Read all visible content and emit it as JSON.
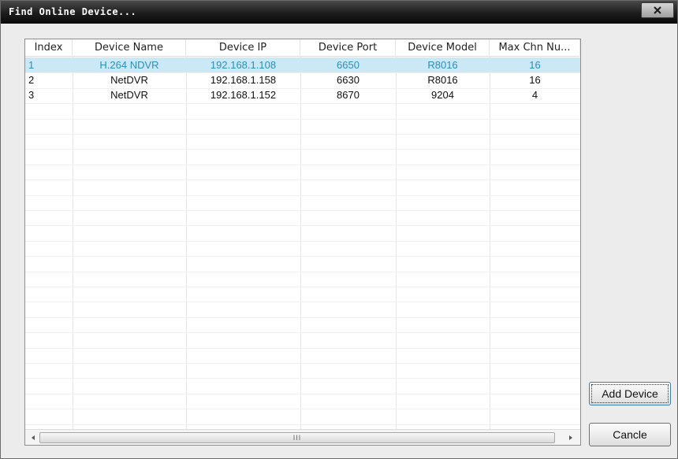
{
  "window": {
    "title": "Find Online Device...",
    "close_glyph": "x"
  },
  "table": {
    "columns": [
      "Index",
      "Device Name",
      "Device IP",
      "Device Port",
      "Device Model",
      "Max Chn Nu..."
    ],
    "rows": [
      {
        "index": "1",
        "name": "H.264 NDVR",
        "ip": "192.168.1.108",
        "port": "6650",
        "model": "R8016",
        "max_chn": "16",
        "selected": true
      },
      {
        "index": "2",
        "name": "NetDVR",
        "ip": "192.168.1.158",
        "port": "6630",
        "model": "R8016",
        "max_chn": "16",
        "selected": false
      },
      {
        "index": "3",
        "name": "NetDVR",
        "ip": "192.168.1.152",
        "port": "8670",
        "model": "9204",
        "max_chn": "4",
        "selected": false
      }
    ]
  },
  "buttons": {
    "add_device": "Add Device",
    "cancel": "Cancle"
  },
  "scrollbar": {
    "grip": "III"
  },
  "colors": {
    "selection_bg": "#cbe8f6",
    "selection_text": "#2b8fc2",
    "titlebar": "#1c1c1c"
  }
}
